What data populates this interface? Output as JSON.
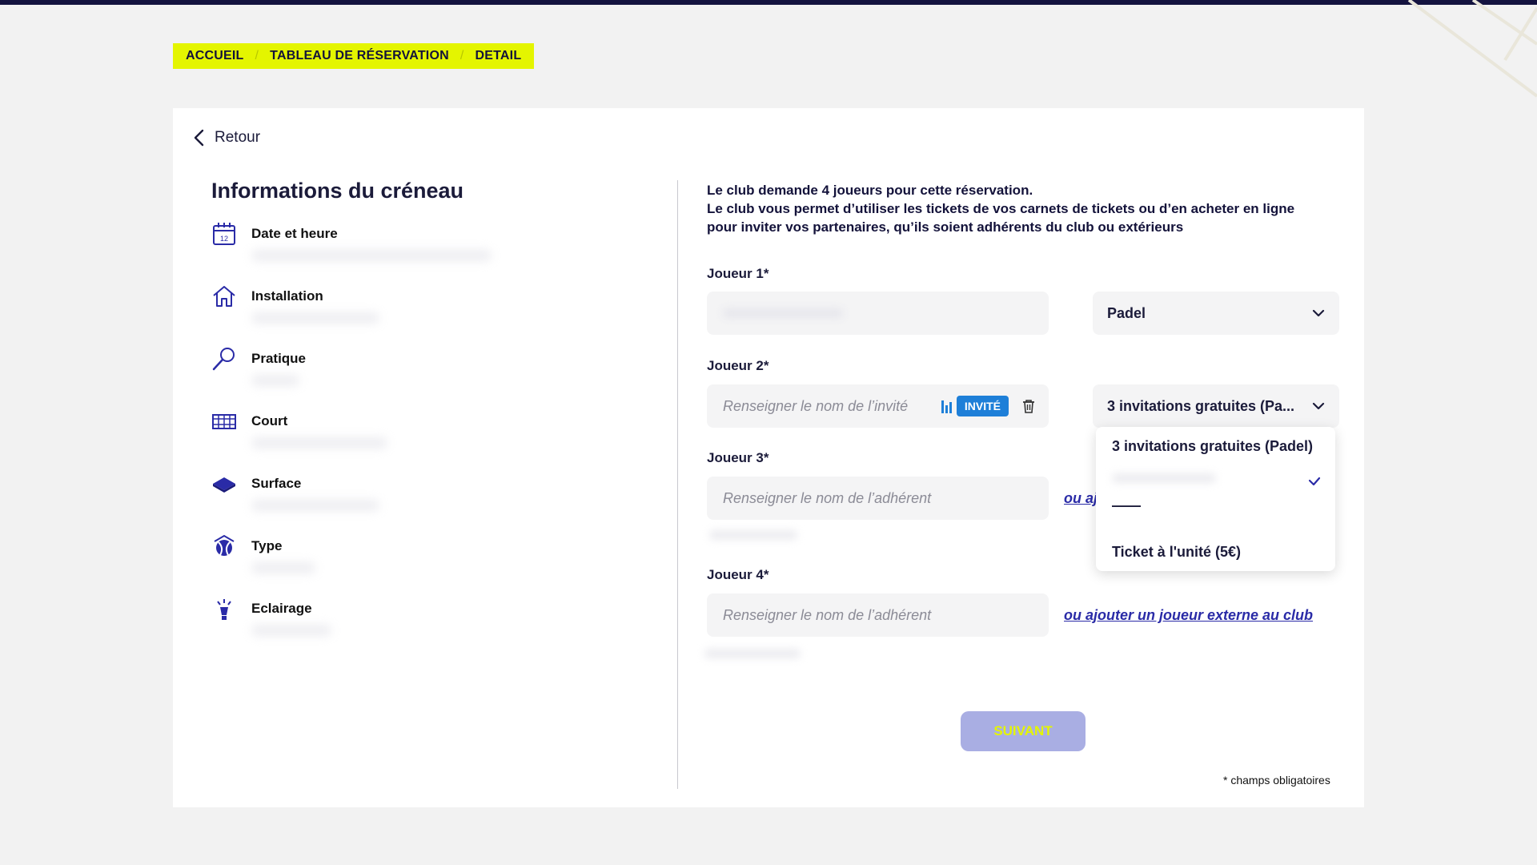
{
  "breadcrumb": {
    "items": [
      {
        "label": "ACCUEIL"
      },
      {
        "label": "TABLEAU DE RÉSERVATION"
      },
      {
        "label": "DETAIL"
      }
    ],
    "separator": "/"
  },
  "back": {
    "label": "Retour"
  },
  "left": {
    "title": "Informations du créneau",
    "items": [
      {
        "label": "Date et heure",
        "icon": "calendar-icon"
      },
      {
        "label": "Installation",
        "icon": "house-icon"
      },
      {
        "label": "Pratique",
        "icon": "racket-icon"
      },
      {
        "label": "Court",
        "icon": "court-icon"
      },
      {
        "label": "Surface",
        "icon": "surface-icon"
      },
      {
        "label": "Type",
        "icon": "ball-icon"
      },
      {
        "label": "Eclairage",
        "icon": "light-icon"
      }
    ],
    "calendar_day": "12"
  },
  "intro": {
    "line1": "Le club demande 4 joueurs pour cette réservation.",
    "line2": "Le club vous permet d’utiliser les tickets de vos carnets de tickets ou d’en acheter en ligne",
    "line3": "pour inviter vos partenaires, qu’ils soient adhérents du club ou extérieurs"
  },
  "players": {
    "p1": {
      "label": "Joueur 1*",
      "select_value": "Padel"
    },
    "p2": {
      "label": "Joueur 2*",
      "placeholder": "Renseigner le nom de l’invité",
      "badge": "INVITÉ",
      "select_value": "3 invitations gratuites (Pa..."
    },
    "p3": {
      "label": "Joueur 3*",
      "placeholder": "Renseigner le nom de l’adhérent",
      "link": "ou aj"
    },
    "p4": {
      "label": "Joueur 4*",
      "placeholder": "Renseigner le nom de l’adhérent",
      "link": "ou ajouter un joueur externe au club"
    }
  },
  "dropdown": {
    "options": [
      {
        "label": "3 invitations gratuites (Padel)"
      },
      {
        "label": "——"
      },
      {
        "label": "Ticket à l'unité (5€)"
      }
    ]
  },
  "submit_label": "SUIVANT",
  "required_note": "* champs obligatoires",
  "colors": {
    "accent_yellow": "#e4f500",
    "navy": "#14133f",
    "link_blue": "#2a2ba7",
    "badge_blue": "#1e7fd8",
    "button_disabled": "#a9aee3"
  }
}
